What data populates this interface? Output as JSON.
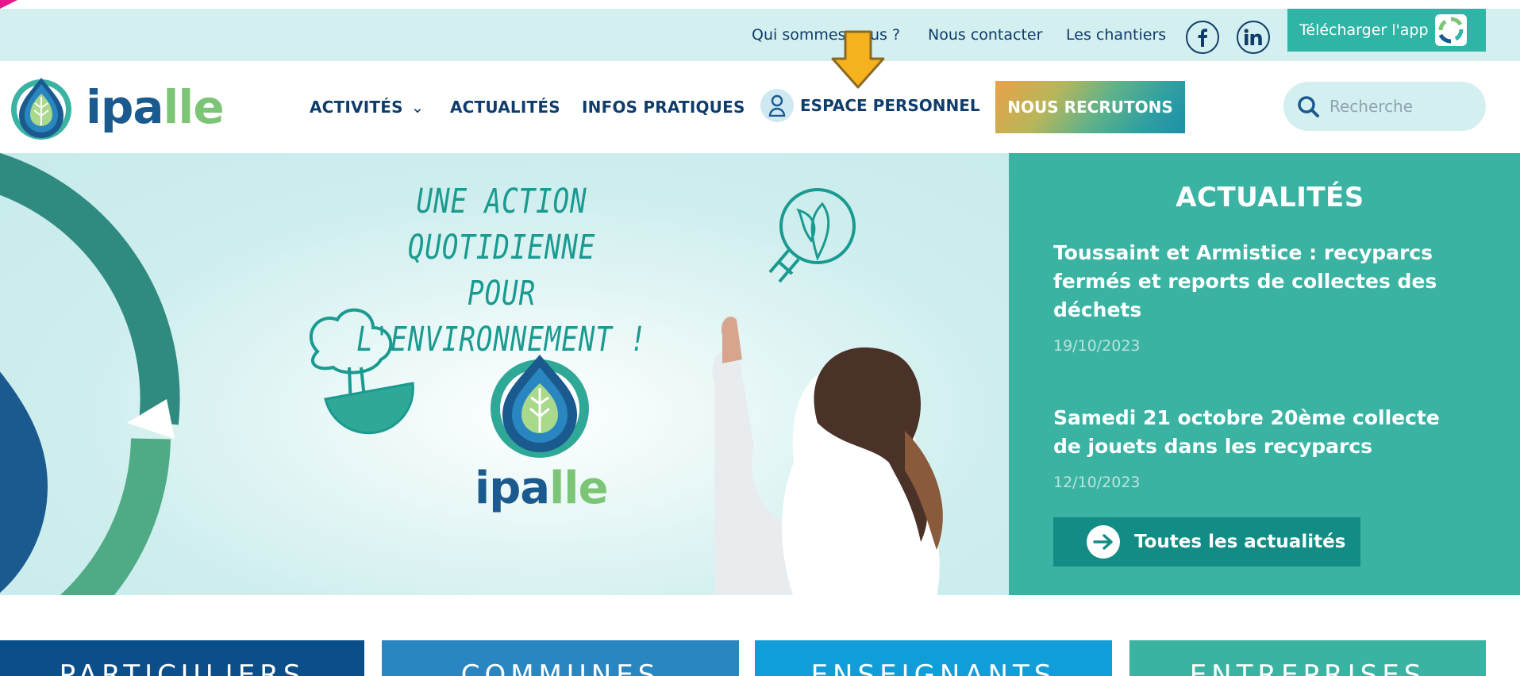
{
  "utility": {
    "links": [
      "Qui sommes-nous ?",
      "Nous contacter",
      "Les chantiers"
    ],
    "social": [
      "facebook-icon",
      "linkedin-icon"
    ],
    "app_label": "Télécharger l'app"
  },
  "header": {
    "brand": "ipalle",
    "nav": {
      "activites": "ACTIVITÉS",
      "actualites": "ACTUALITÉS",
      "infos": "INFOS PRATIQUES",
      "espace": "ESPACE PERSONNEL"
    },
    "recrut_label": "NOUS RECRUTONS",
    "search_placeholder": "Recherche"
  },
  "hero": {
    "title_line1": "UNE ACTION QUOTIDIENNE",
    "title_line2": "POUR L'ENVIRONNEMENT !",
    "brand": "ipalle"
  },
  "news": {
    "title": "ACTUALITÉS",
    "items": [
      {
        "headline": "Toussaint et Armistice : recyparcs fermés et reports de collectes des déchets",
        "date": "19/10/2023"
      },
      {
        "headline": "Samedi 21 octobre 20ème collecte de jouets dans les recyparcs",
        "date": "12/10/2023"
      }
    ],
    "all_label": "Toutes les actualités"
  },
  "tiles": [
    {
      "label": "PARTICULIERS",
      "color": "#0b4f8a"
    },
    {
      "label": "COMMUNES",
      "color": "#2a86c0"
    },
    {
      "label": "ENSEIGNANTS",
      "color": "#119ed8"
    },
    {
      "label": "ENTREPRISES",
      "color": "#3ab3a3"
    }
  ],
  "colors": {
    "navy": "#0f3d6b",
    "teal": "#3ab3a3",
    "light_teal": "#d4eff0",
    "green": "#7cc576",
    "annotation": "#f5b21c"
  }
}
